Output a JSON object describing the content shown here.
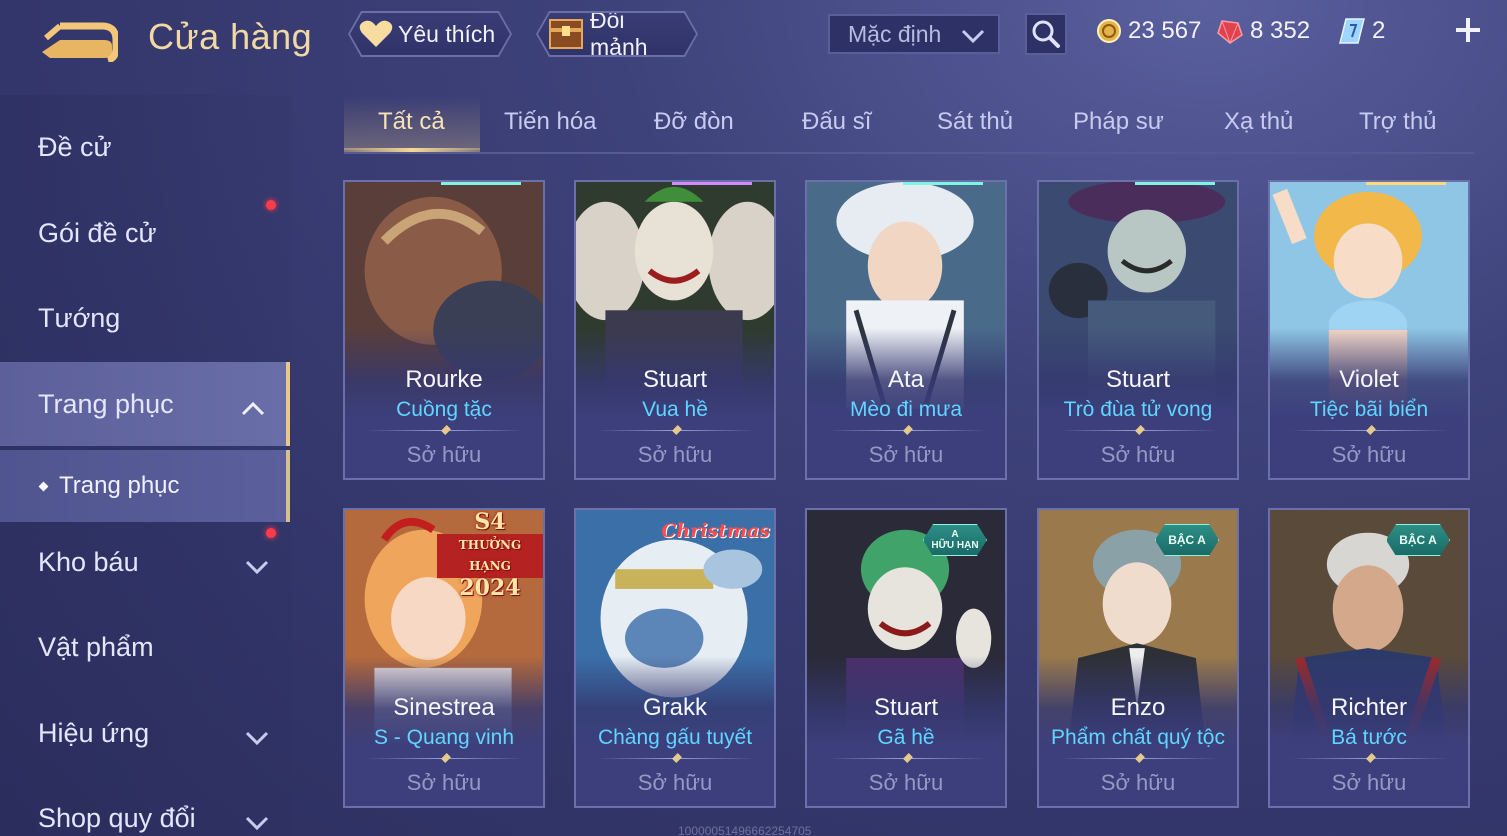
{
  "header": {
    "title": "Cửa hàng",
    "favorites_label": "Yêu thích",
    "exchange_label": "Đổi mảnh",
    "sort_value": "Mặc định",
    "gold": "23 567",
    "gems": "8 352",
    "vouchers": "2"
  },
  "sidebar": {
    "items": [
      {
        "label": "Đề cử"
      },
      {
        "label": "Gói đề cử"
      },
      {
        "label": "Tướng"
      },
      {
        "label": "Trang phục"
      },
      {
        "label": "Kho báu"
      },
      {
        "label": "Vật phẩm"
      },
      {
        "label": "Hiệu ứng"
      },
      {
        "label": "Shop quy đổi"
      }
    ],
    "sub_item": "Trang phục"
  },
  "tabs": [
    "Tất cả",
    "Tiến hóa",
    "Đỡ đòn",
    "Đấu sĩ",
    "Sát thủ",
    "Pháp sư",
    "Xạ thủ",
    "Trợ thủ"
  ],
  "cards": [
    {
      "hero": "Rourke",
      "skin": "Cuồng tặc",
      "status": "Sở hữu"
    },
    {
      "hero": "Stuart",
      "skin": "Vua hề",
      "status": "Sở hữu"
    },
    {
      "hero": "Ata",
      "skin": "Mèo đi mưa",
      "status": "Sở hữu"
    },
    {
      "hero": "Stuart",
      "skin": "Trò đùa tử vong",
      "status": "Sở hữu"
    },
    {
      "hero": "Violet",
      "skin": "Tiệc bãi biển",
      "status": "Sở hữu"
    },
    {
      "hero": "Sinestrea",
      "skin": "S - Quang vinh",
      "status": "Sở hữu",
      "banner_top": "S4",
      "banner_mid": "THƯỞNG HẠNG",
      "banner_year": "2024"
    },
    {
      "hero": "Grakk",
      "skin": "Chàng gấu tuyết",
      "status": "Sở hữu",
      "banner": "Christmas"
    },
    {
      "hero": "Stuart",
      "skin": "Gã hề",
      "status": "Sở hữu",
      "badge_top": "A",
      "badge_bottom": "HỮU HẠN"
    },
    {
      "hero": "Enzo",
      "skin": "Phẩm chất quý tộc",
      "status": "Sở hữu",
      "badge": "BẬC A"
    },
    {
      "hero": "Richter",
      "skin": "Bá tước",
      "status": "Sở hữu",
      "badge": "BẬC A"
    }
  ],
  "watermark": "10000051496662254705",
  "colors": {
    "accent_gold": "#f1d9a6",
    "skin_cyan": "#5fd6ff",
    "badge_teal": "#2c8f86",
    "notify_red": "#ff3b4a"
  },
  "icons": [
    "back-arrow-icon",
    "heart-icon",
    "chest-icon",
    "chevron-down-icon",
    "search-icon",
    "gold-coin-icon",
    "red-gem-icon",
    "voucher-icon",
    "plus-icon",
    "chevron-up-icon"
  ]
}
